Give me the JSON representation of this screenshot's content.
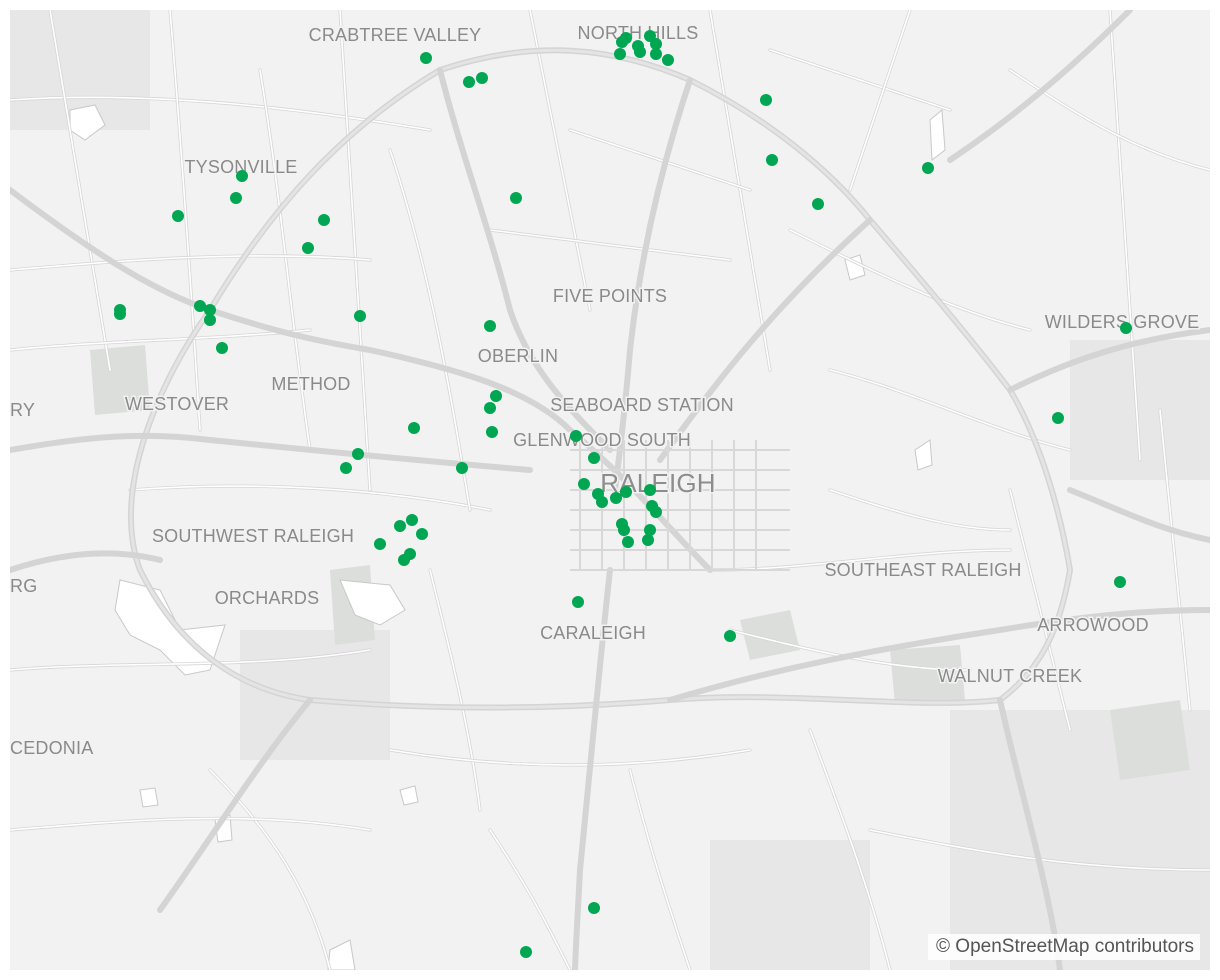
{
  "map": {
    "labels": [
      {
        "id": "crabtree-valley",
        "text": "CRABTREE VALLEY"
      },
      {
        "id": "north-hills",
        "text": "NORTH HILLS"
      },
      {
        "id": "tysonville",
        "text": "TYSONVILLE"
      },
      {
        "id": "five-points",
        "text": "FIVE POINTS"
      },
      {
        "id": "wilders-grove",
        "text": "WILDERS GROVE"
      },
      {
        "id": "oberlin",
        "text": "OBERLIN"
      },
      {
        "id": "method",
        "text": "METHOD"
      },
      {
        "id": "westover",
        "text": "WESTOVER"
      },
      {
        "id": "ry-edge",
        "text": "RY"
      },
      {
        "id": "seaboard-station",
        "text": "SEABOARD STATION"
      },
      {
        "id": "glenwood-south",
        "text": "GLENWOOD SOUTH"
      },
      {
        "id": "raleigh",
        "text": "RALEIGH"
      },
      {
        "id": "southwest-raleigh",
        "text": "SOUTHWEST RALEIGH"
      },
      {
        "id": "southeast-raleigh",
        "text": "SOUTHEAST RALEIGH"
      },
      {
        "id": "rg-edge",
        "text": "RG"
      },
      {
        "id": "orchards",
        "text": "ORCHARDS"
      },
      {
        "id": "caraleigh",
        "text": "CARALEIGH"
      },
      {
        "id": "arrowood",
        "text": "ARROWOOD"
      },
      {
        "id": "walnut-creek",
        "text": "WALNUT CREEK"
      },
      {
        "id": "cedonia-edge",
        "text": "CEDONIA"
      }
    ],
    "marker_color": "#00a651",
    "marker_icon": "circle-marker",
    "marker_count": 66
  },
  "attribution": {
    "text": "© OpenStreetMap contributors"
  }
}
